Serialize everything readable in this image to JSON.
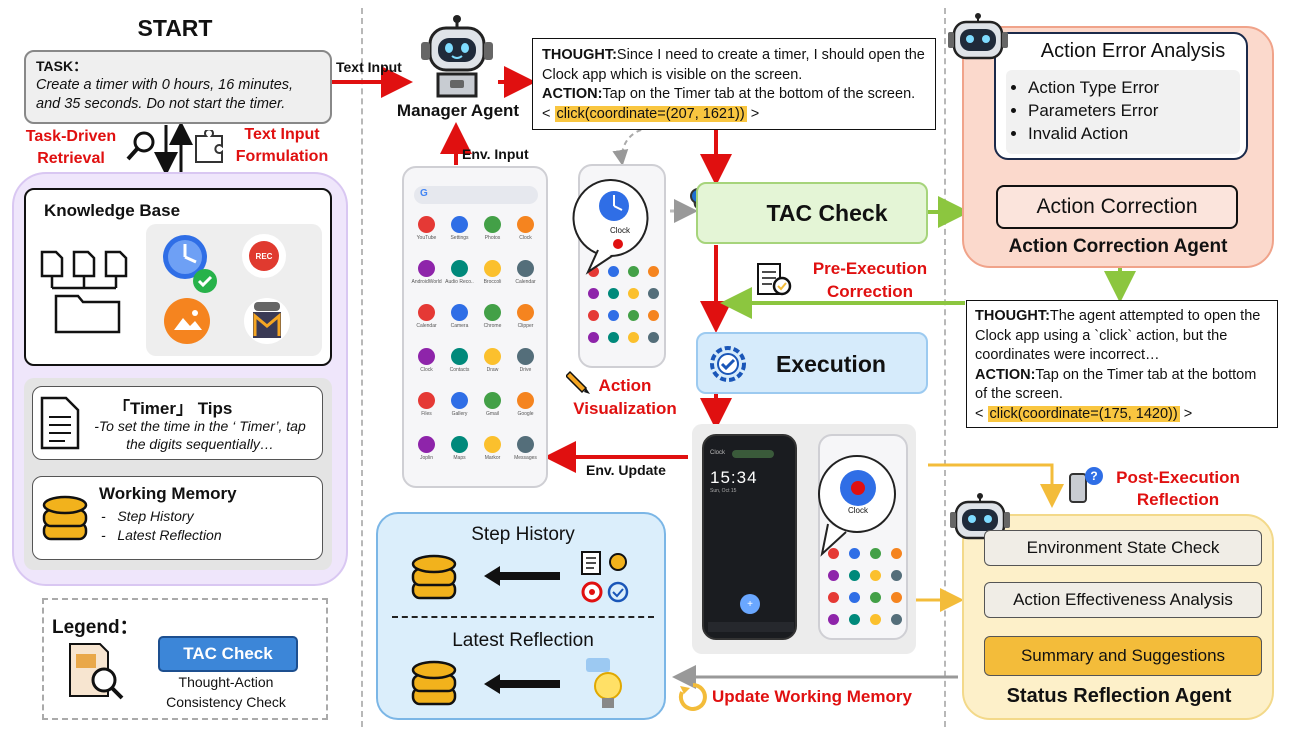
{
  "start": {
    "title": "START",
    "task_label": "TASK",
    "task_text": "Create a timer with 0 hours, 16 minutes, and 35 seconds. Do not start the timer.",
    "retrieval_label": "Task-Driven\nRetrieval",
    "formulation_label": "Text Input\nFormulation",
    "kb_title": "Knowledge Base",
    "rec_label": "REC",
    "tips_title": "「Timer」 Tips",
    "tips_text": "-To set the time in the ‘ Timer’, tap the digits sequentially…",
    "wm_title": "Working Memory",
    "wm_items": [
      "Step History",
      "Latest Reflection"
    ]
  },
  "legend": {
    "title": "Legend：",
    "badge": "TAC Check",
    "desc": "Thought-Action\nConsistency Check"
  },
  "manager": {
    "text_input": "Text Input",
    "title": "Manager Agent",
    "env_input": "Env. Input",
    "thought_label": "THOUGHT:",
    "thought_text": "Since I need to create a timer, I should open the Clock app which is visible on the screen.",
    "action_label": "ACTION:",
    "action_text": "Tap on the Timer tab at the bottom of the screen. <",
    "action_call": "click(coordinate=(207, 1621))",
    "action_end": ">"
  },
  "phone_apps": [
    [
      "YouTube",
      "Settings",
      "Photos",
      "Clock"
    ],
    [
      "AndroidWorld",
      "Audio Reco..",
      "Broccoli",
      "Calendar"
    ],
    [
      "Calendar",
      "Camera",
      "Chrome",
      "Clipper"
    ],
    [
      "Clock",
      "Contacts",
      "Draw",
      "Drive"
    ],
    [
      "Files",
      "Gallery",
      "Gmail",
      "Google"
    ],
    [
      "Joplin",
      "Maps",
      "Markor",
      "Messages"
    ]
  ],
  "vis": {
    "clock_label": "Clock",
    "action_vis": "Action\nVisualization"
  },
  "tac": {
    "title": "TAC Check",
    "pre_exec": "Pre-Execution\nCorrection",
    "execution": "Execution",
    "env_update": "Env. Update"
  },
  "error_agent": {
    "analysis_title": "Action Error Analysis",
    "errors": [
      "Action Type Error",
      "Parameters Error",
      "Invalid Action"
    ],
    "correction": "Action Correction",
    "agent_name": "Action Correction Agent",
    "thought_label": "THOUGHT:",
    "thought_text": "The agent attempted to open the Clock app using a `click` action, but the coordinates were incorrect…",
    "action_label": "ACTION:",
    "action_text": "Tap on the Timer tab at the bottom of the screen.",
    "action_pre": "<",
    "action_call": "click(coordinate=(175, 1420))",
    "action_end": ">"
  },
  "exec_screens": {
    "clock_time": "15:34",
    "clock_date": "Sun, Oct 15",
    "clock_header": "Clock",
    "clock_label": "Clock"
  },
  "memory": {
    "step_history": "Step History",
    "latest_reflection": "Latest Reflection",
    "update_label": "Update Working Memory"
  },
  "reflection": {
    "post_exec": "Post-Execution\nReflection",
    "steps": [
      "Environment State Check",
      "Action Effectiveness Analysis",
      "Summary and Suggestions"
    ],
    "agent_name": "Status Reflection Agent"
  },
  "colors": {
    "red": "#e01010",
    "green": "#8cc63f",
    "purple_bg": "#efe6fb",
    "blue_bg": "#dbeefb",
    "salmon_bg": "#fbd9cc",
    "yellow_bg": "#fdf0c9",
    "tac_green": "#e4f5d6",
    "exec_blue": "#d6ebfb",
    "gold": "#f3bc3a"
  }
}
